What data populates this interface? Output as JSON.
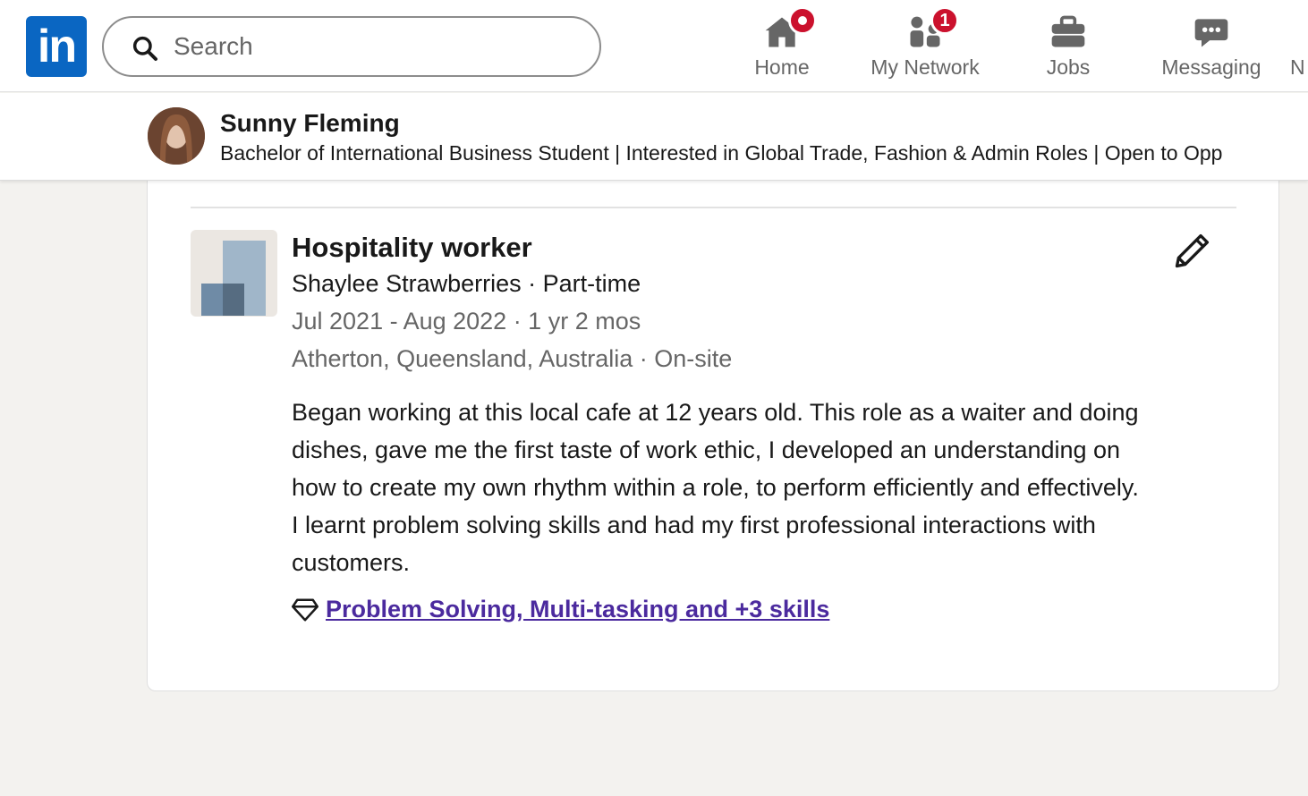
{
  "nav": {
    "logo_text": "in",
    "search_placeholder": "Search",
    "items": [
      {
        "label": "Home",
        "icon": "home-icon",
        "badge": ""
      },
      {
        "label": "My Network",
        "icon": "people-icon",
        "badge": "1"
      },
      {
        "label": "Jobs",
        "icon": "briefcase-icon",
        "badge": ""
      },
      {
        "label": "Messaging",
        "icon": "chat-icon",
        "badge": ""
      }
    ],
    "clipped_item_text": "N",
    "accent_color": "#0a66c2",
    "badge_color": "#cb112d"
  },
  "profile": {
    "name": "Sunny Fleming",
    "headline": "Bachelor of International Business Student | Interested in Global Trade, Fashion & Admin Roles | Open to Opp"
  },
  "experience": {
    "title": "Hospitality worker",
    "company_line": "Shaylee Strawberries · Part-time",
    "dates_line": "Jul 2021 - Aug 2022 · 1 yr 2 mos",
    "location_line": "Atherton, Queensland, Australia · On-site",
    "description": "Began working at this local cafe at 12 years old. This role as a waiter and doing dishes, gave me the first taste of work ethic, I developed an understanding on how to create my own rhythm within a role, to perform efficiently and effectively. I learnt problem solving skills and had my first professional interactions with customers.",
    "skills_link": " Problem Solving, Multi-tasking and +3 skills",
    "skills_icon": "diamond-icon",
    "edit_icon": "pencil-icon",
    "link_color": "#4b2a9e"
  }
}
